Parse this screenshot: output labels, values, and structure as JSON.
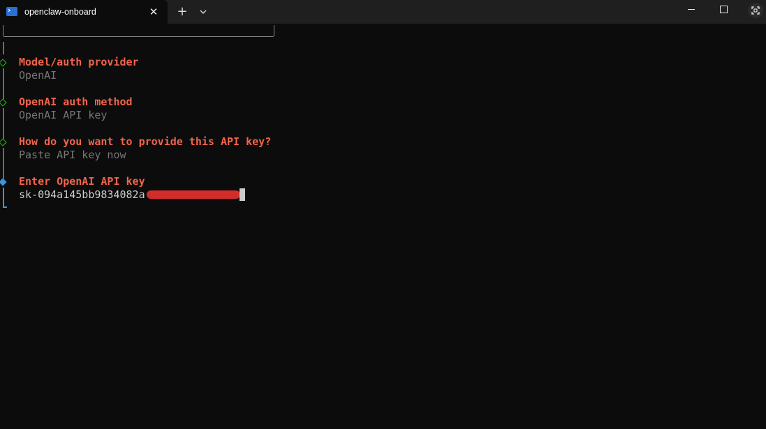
{
  "window": {
    "tab_title": "openclaw-onboard",
    "tab_icon": "powershell-icon",
    "close_tab_icon": "close-icon",
    "new_tab_icon": "plus-icon",
    "dropdown_icon": "chevron-down-icon",
    "minimize_icon": "minimize-icon",
    "maximize_icon": "maximize-icon",
    "focus_icon": "focus-mode-icon"
  },
  "terminal": {
    "steps": [
      {
        "question": "Model/auth provider",
        "answer": "OpenAI"
      },
      {
        "question": "OpenAI auth method",
        "answer": "OpenAI API key"
      },
      {
        "question": "How do you want to provide this API key?",
        "answer": "Paste API key now"
      }
    ],
    "active_step": {
      "question": "Enter OpenAI API key",
      "input_value": "sk-094a145bb9834082a"
    }
  },
  "colors": {
    "background": "#0c0c0c",
    "question": "#f2634b",
    "answer": "#767676",
    "done_marker": "#16c60c",
    "active_marker": "#3a96dd",
    "redaction": "#e8302f"
  }
}
